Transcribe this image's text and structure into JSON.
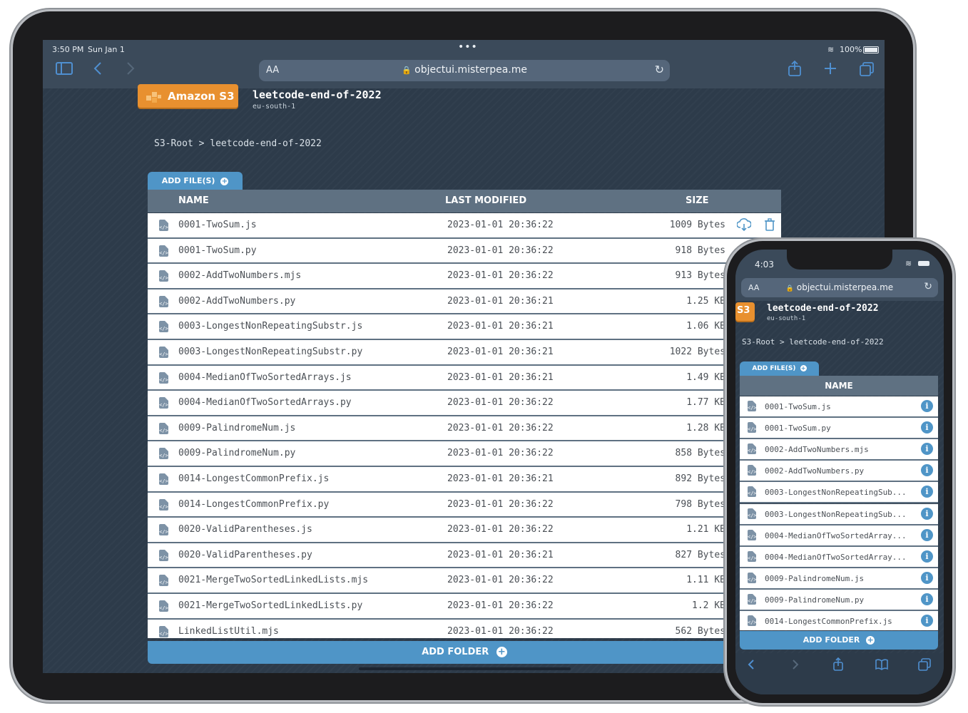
{
  "ipad": {
    "status": {
      "time": "3:50 PM",
      "date": "Sun Jan 1",
      "battery": "100%"
    },
    "safari": {
      "aa": "AA",
      "url": "objectui.misterpea.me"
    },
    "logo_text": "Amazon S3",
    "bucket": {
      "name": "leetcode-end-of-2022",
      "region": "eu-south-1"
    },
    "breadcrumb": "S3-Root > leetcode-end-of-2022",
    "add_files_label": "ADD FILE(S)",
    "columns": {
      "name": "NAME",
      "modified": "LAST MODIFIED",
      "size": "SIZE"
    },
    "files": [
      {
        "name": "0001-TwoSum.js",
        "modified": "2023-01-01 20:36:22",
        "size": "1009 Bytes"
      },
      {
        "name": "0001-TwoSum.py",
        "modified": "2023-01-01 20:36:22",
        "size": "918 Bytes"
      },
      {
        "name": "0002-AddTwoNumbers.mjs",
        "modified": "2023-01-01 20:36:22",
        "size": "913 Bytes"
      },
      {
        "name": "0002-AddTwoNumbers.py",
        "modified": "2023-01-01 20:36:21",
        "size": "1.25 KB"
      },
      {
        "name": "0003-LongestNonRepeatingSubstr.js",
        "modified": "2023-01-01 20:36:21",
        "size": "1.06 KB"
      },
      {
        "name": "0003-LongestNonRepeatingSubstr.py",
        "modified": "2023-01-01 20:36:21",
        "size": "1022 Bytes"
      },
      {
        "name": "0004-MedianOfTwoSortedArrays.js",
        "modified": "2023-01-01 20:36:21",
        "size": "1.49 KB"
      },
      {
        "name": "0004-MedianOfTwoSortedArrays.py",
        "modified": "2023-01-01 20:36:22",
        "size": "1.77 KB"
      },
      {
        "name": "0009-PalindromeNum.js",
        "modified": "2023-01-01 20:36:22",
        "size": "1.28 KB"
      },
      {
        "name": "0009-PalindromeNum.py",
        "modified": "2023-01-01 20:36:22",
        "size": "858 Bytes"
      },
      {
        "name": "0014-LongestCommonPrefix.js",
        "modified": "2023-01-01 20:36:21",
        "size": "892 Bytes"
      },
      {
        "name": "0014-LongestCommonPrefix.py",
        "modified": "2023-01-01 20:36:22",
        "size": "798 Bytes"
      },
      {
        "name": "0020-ValidParentheses.js",
        "modified": "2023-01-01 20:36:22",
        "size": "1.21 KB"
      },
      {
        "name": "0020-ValidParentheses.py",
        "modified": "2023-01-01 20:36:21",
        "size": "827 Bytes"
      },
      {
        "name": "0021-MergeTwoSortedLinkedLists.mjs",
        "modified": "2023-01-01 20:36:22",
        "size": "1.11 KB"
      },
      {
        "name": "0021-MergeTwoSortedLinkedLists.py",
        "modified": "2023-01-01 20:36:22",
        "size": "1.2 KB"
      },
      {
        "name": "LinkedListUtil.mjs",
        "modified": "2023-01-01 20:36:22",
        "size": "562 Bytes"
      }
    ],
    "add_folder_label": "ADD FOLDER"
  },
  "iphone": {
    "status": {
      "time": "4:03"
    },
    "safari": {
      "aa": "AA",
      "url": "objectui.misterpea.me"
    },
    "logo_text": "S3",
    "bucket": {
      "name": "leetcode-end-of-2022",
      "region": "eu-south-1"
    },
    "breadcrumb": "S3-Root > leetcode-end-of-2022",
    "add_files_label": "ADD FILE(S)",
    "column_name": "NAME",
    "files": [
      "0001-TwoSum.js",
      "0001-TwoSum.py",
      "0002-AddTwoNumbers.mjs",
      "0002-AddTwoNumbers.py",
      "0003-LongestNonRepeatingSub...",
      "0003-LongestNonRepeatingSub...",
      "0004-MedianOfTwoSortedArray...",
      "0004-MedianOfTwoSortedArray...",
      "0009-PalindromeNum.js",
      "0009-PalindromeNum.py",
      "0014-LongestCommonPrefix.js"
    ],
    "info_glyph": "i",
    "add_folder_label": "ADD FOLDER"
  },
  "colors": {
    "accent": "#4f95c7",
    "header": "#5f7182",
    "background": "#2d3b4a",
    "s3_orange": "#e8902f"
  }
}
